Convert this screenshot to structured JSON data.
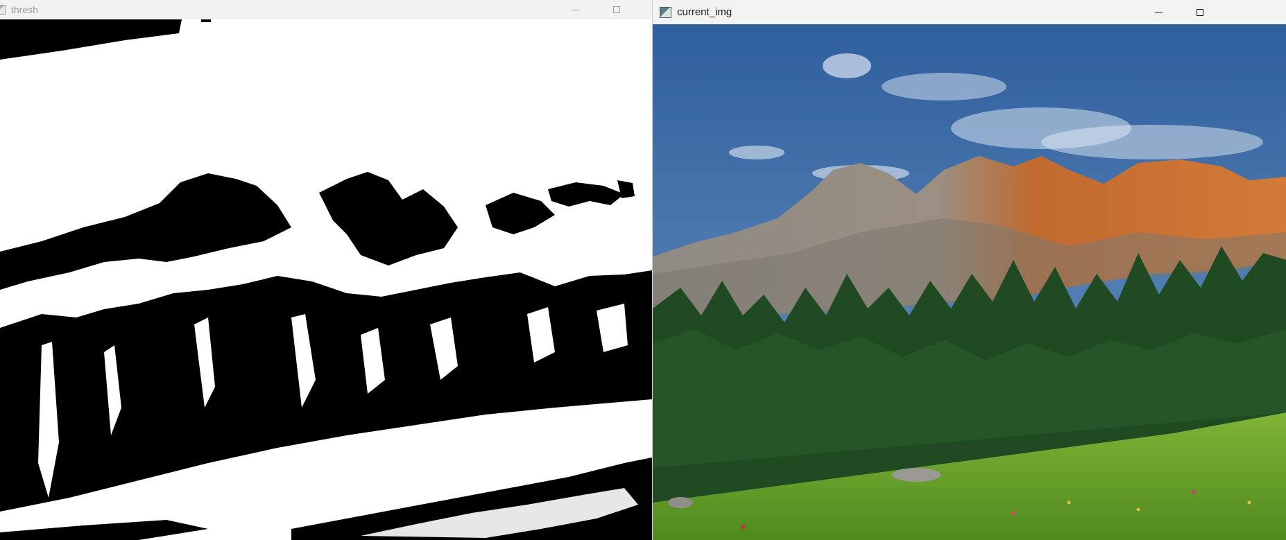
{
  "windows": {
    "thresh": {
      "title": "thresh",
      "icon": "opencv-window-icon"
    },
    "current": {
      "title": "current_img",
      "icon": "opencv-window-icon"
    }
  },
  "colors": {
    "titlebar_bg": "#f3f3f3",
    "sky": "#3f6fa8",
    "rock_lit": "#c8702f",
    "forest": "#1f4a22",
    "meadow": "#6aa02a"
  }
}
